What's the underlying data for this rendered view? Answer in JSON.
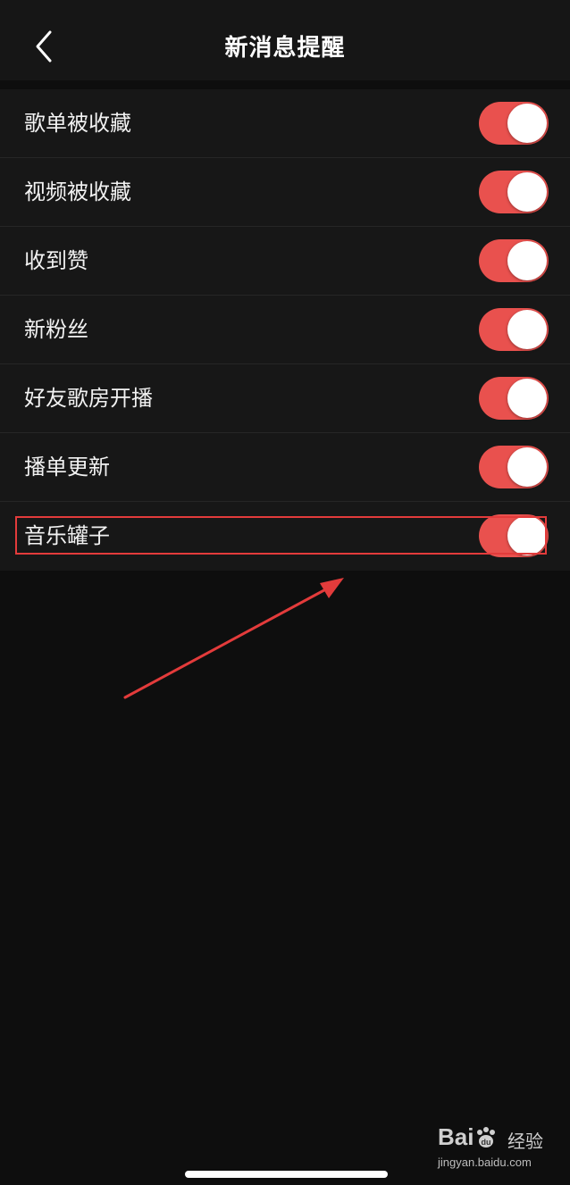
{
  "header": {
    "title": "新消息提醒"
  },
  "settings": {
    "items": [
      {
        "label": "歌单被收藏",
        "on": true
      },
      {
        "label": "视频被收藏",
        "on": true
      },
      {
        "label": "收到赞",
        "on": true
      },
      {
        "label": "新粉丝",
        "on": true
      },
      {
        "label": "好友歌房开播",
        "on": true
      },
      {
        "label": "播单更新",
        "on": true
      },
      {
        "label": "音乐罐子",
        "on": true
      }
    ]
  },
  "colors": {
    "toggle_on": "#e9514e",
    "annotation": "#e33b3b",
    "background": "#0e0e0e"
  },
  "watermark": {
    "brand": "Bai",
    "brand2": "du",
    "cn": "经验",
    "url": "jingyan.baidu.com"
  }
}
